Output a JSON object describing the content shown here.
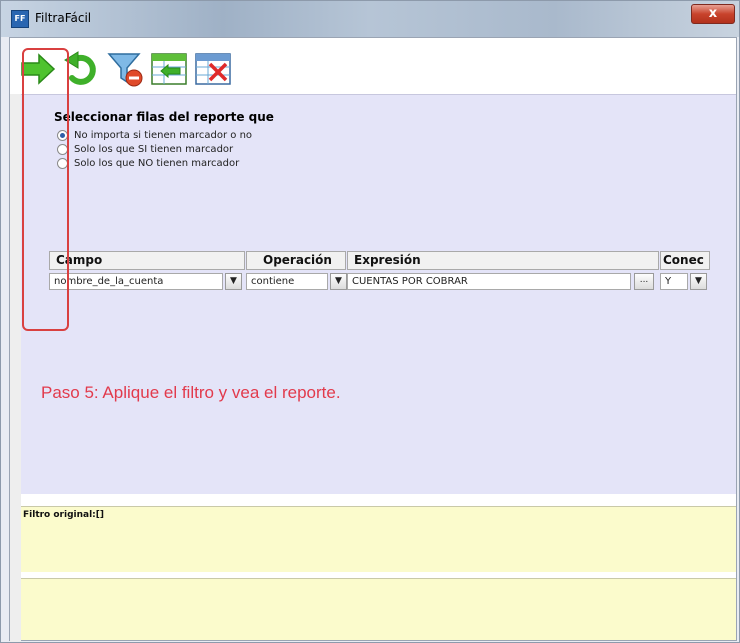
{
  "window": {
    "title": "FiltraFácil",
    "icon_text": "FF",
    "close_label": "x"
  },
  "toolbar": {
    "buttons": [
      {
        "name": "apply-filter",
        "icon": "green-arrow-right-icon"
      },
      {
        "name": "undo",
        "icon": "green-undo-arrow-icon"
      },
      {
        "name": "clear-filter",
        "icon": "funnel-remove-icon"
      },
      {
        "name": "insert-row",
        "icon": "insert-row-icon"
      },
      {
        "name": "delete-row",
        "icon": "delete-row-icon"
      }
    ]
  },
  "selection": {
    "title": "Seleccionar filas del reporte que",
    "options": [
      {
        "label": "No importa si tienen marcador o no",
        "selected": true
      },
      {
        "label": "Solo los que SI tienen marcador",
        "selected": false
      },
      {
        "label": "Solo los que NO tienen marcador",
        "selected": false
      }
    ]
  },
  "grid": {
    "headers": {
      "campo": "Campo",
      "operacion": "Operación",
      "expresion": "Expresión",
      "conector": "Conec"
    },
    "row": {
      "campo": "nombre_de_la_cuenta",
      "operacion": "contiene",
      "expresion": "CUENTAS POR COBRAR",
      "conector": "Y",
      "ellipsis": "..."
    }
  },
  "annotation": {
    "step_text": "Paso 5: Aplique el filtro y vea el reporte.",
    "highlight_color": "#d94040"
  },
  "filter": {
    "label": "Filtro original:[]"
  },
  "colors": {
    "panel": "#e4e4f8",
    "filter_area": "#fbfbcc",
    "step_text": "#e23a4c"
  }
}
